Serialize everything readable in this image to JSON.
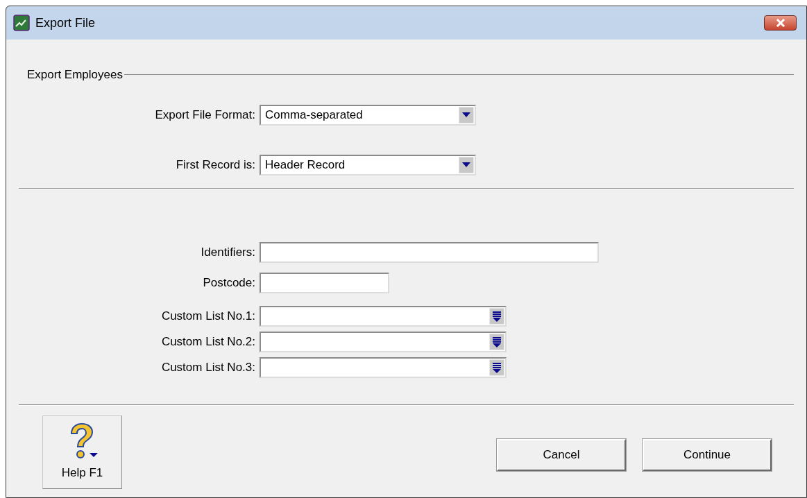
{
  "window": {
    "title": "Export File"
  },
  "section": {
    "title": "Export Employees"
  },
  "format_fields": [
    {
      "label": "Export File Format:",
      "value": "Comma-separated"
    },
    {
      "label": "First Record is:",
      "value": "Header Record"
    }
  ],
  "filter_fields": [
    {
      "kind": "text",
      "label": "Identifiers:"
    },
    {
      "kind": "short-text",
      "label": "Postcode:"
    },
    {
      "kind": "list",
      "label": "Custom List No.1:"
    },
    {
      "kind": "list",
      "label": "Custom List No.2:"
    },
    {
      "kind": "list",
      "label": "Custom List No.3:"
    }
  ],
  "help_button": {
    "label": "Help F1"
  },
  "buttons": [
    "Cancel",
    "Continue"
  ]
}
